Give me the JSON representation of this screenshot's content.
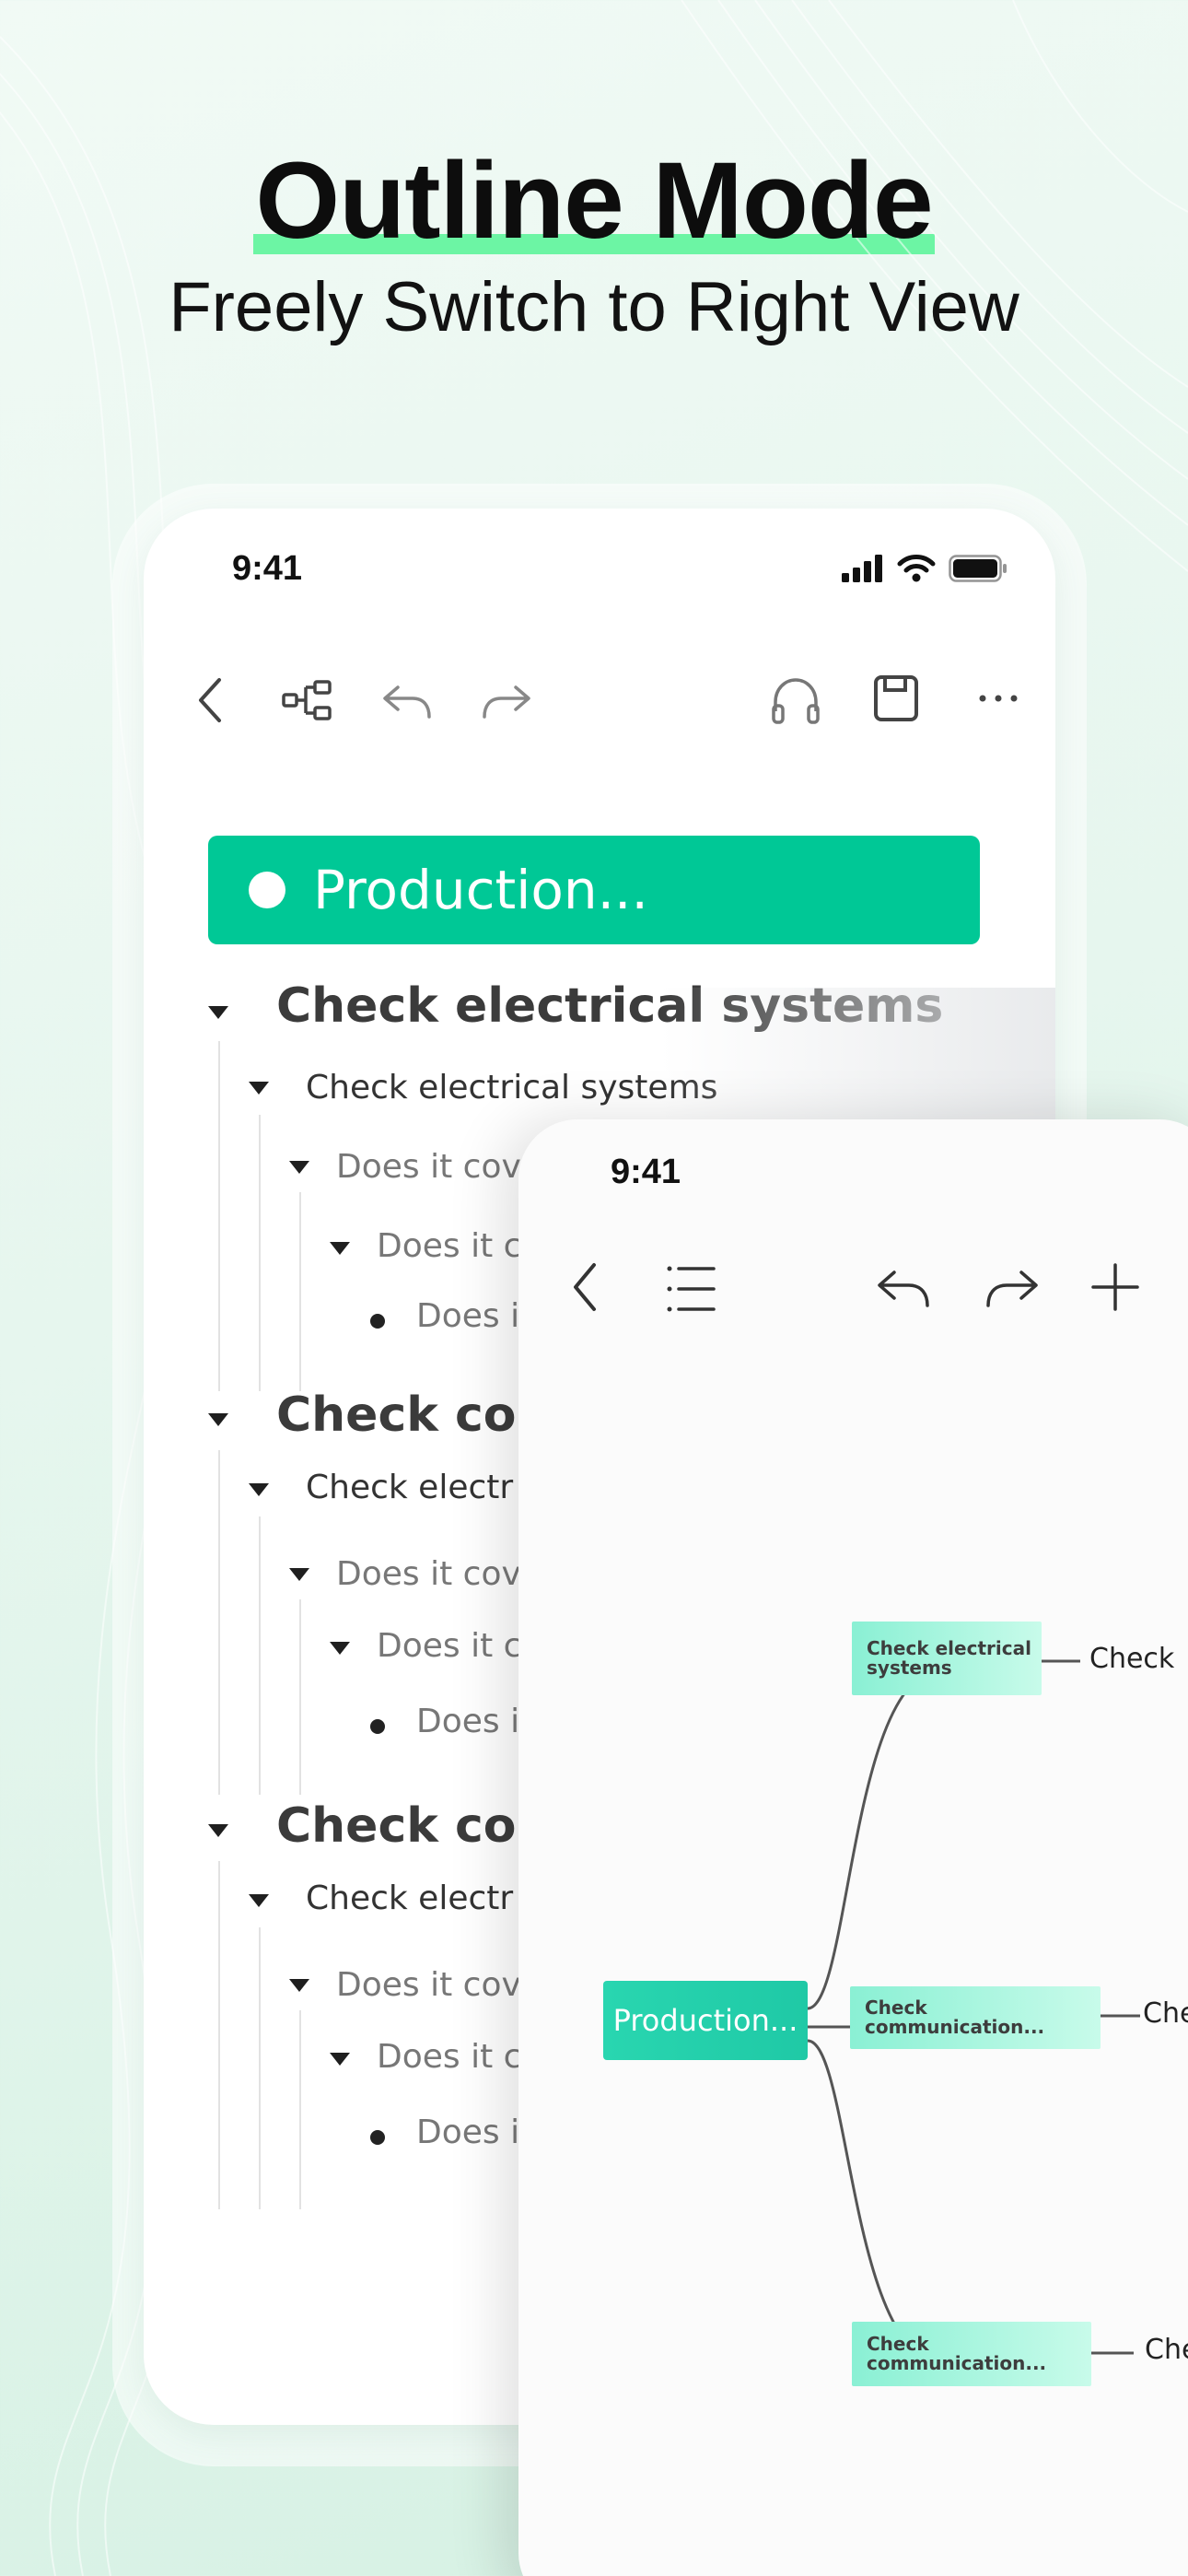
{
  "header": {
    "title": "Outline Mode",
    "subtitle": "Freely Switch to Right View"
  },
  "outline_phone": {
    "time": "9:41",
    "toolbar_icons": [
      "back-icon",
      "mindmap-view-icon",
      "undo-icon",
      "redo-icon",
      "headphones-icon",
      "save-icon",
      "more-icon"
    ],
    "root_label": "Production...",
    "sections": [
      {
        "title": "Check electrical systems",
        "child": "Check electrical systems",
        "grandchild": "Does it cov",
        "great_grandchild": "Does it c",
        "leaf": "Does i"
      },
      {
        "title": "Check cor",
        "child": "Check electr",
        "grandchild": "Does it cov",
        "great_grandchild": "Does it c",
        "leaf": "Does i"
      },
      {
        "title": "Check cor",
        "child": "Check electr",
        "grandchild": "Does it cov",
        "great_grandchild": "Does it c",
        "leaf": "Does i"
      }
    ]
  },
  "mindmap_phone": {
    "time": "9:41",
    "toolbar_icons": [
      "back-icon",
      "outline-list-icon",
      "undo-icon",
      "redo-icon",
      "add-icon"
    ],
    "root_label": "Production...",
    "branches": [
      {
        "label": "Check electrical systems",
        "leaf": "Check"
      },
      {
        "label": "Check communication...",
        "leaf": "Che"
      },
      {
        "label": "Check communication...",
        "leaf": "Che"
      }
    ]
  },
  "colors": {
    "accent": "#00c896",
    "highlight": "#6cf5a4",
    "mindmap_root": "#1fc9a6",
    "mindmap_child": "#a8f5df"
  }
}
